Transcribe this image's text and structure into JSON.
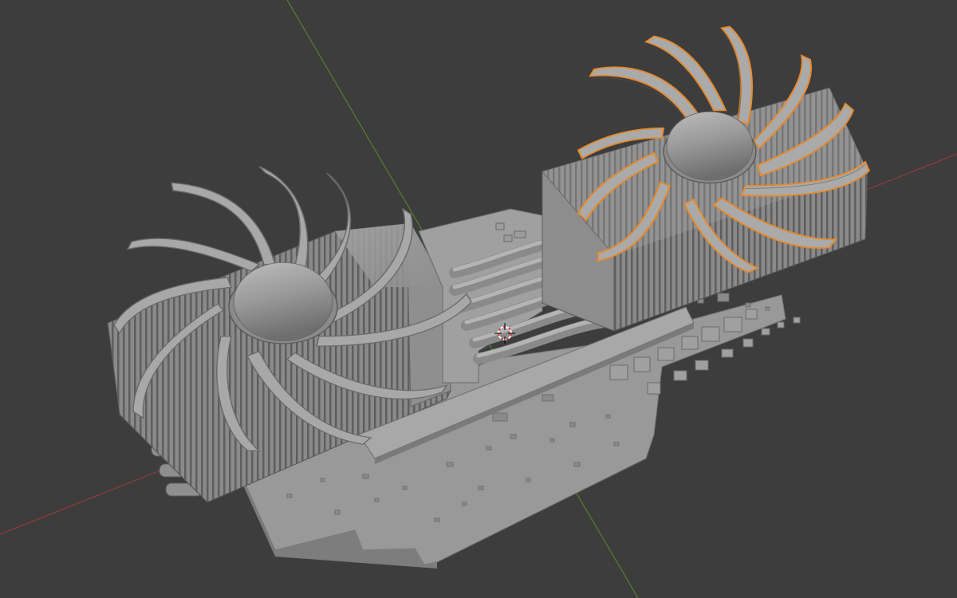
{
  "viewport": {
    "background": "#3d3d3d",
    "selection_outline_color": "#e8892a",
    "x_axis_color": "#a83a3a",
    "y_axis_color": "#5d8a2a",
    "mesh_color": "#9c9c9c"
  },
  "scene": {
    "objects": [
      {
        "name": "left-fan",
        "selected": false
      },
      {
        "name": "right-fan",
        "selected": true
      },
      {
        "name": "left-heatsink",
        "selected": false
      },
      {
        "name": "right-heatsink",
        "selected": false
      },
      {
        "name": "heatpipes",
        "selected": false
      },
      {
        "name": "pcb-board",
        "selected": false
      },
      {
        "name": "io-bracket-ports",
        "selected": false
      }
    ],
    "fan_blade_count": 12,
    "heatpipe_count": 6,
    "cursor": "3d-cursor"
  }
}
